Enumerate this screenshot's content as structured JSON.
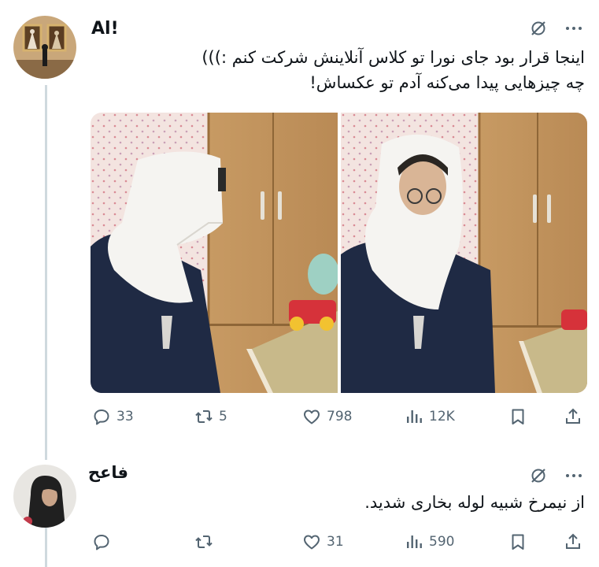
{
  "tweet": {
    "author_name": "Al!",
    "text_line1": "اینجا قرار بود جای نورا تو کلاس آنلاینش شرکت کنم :)))",
    "text_line2": "چه چیزهایی پیدا می‌کنه آدم تو عکساش!",
    "icons": {
      "grok": "grok-icon",
      "more": "more-icon"
    },
    "actions": {
      "replies": {
        "icon": "reply-icon",
        "count": "33"
      },
      "reposts": {
        "icon": "repost-icon",
        "count": "5"
      },
      "likes": {
        "icon": "heart-icon",
        "count": "798"
      },
      "views": {
        "icon": "views-icon",
        "count": "12K"
      },
      "bookmark": {
        "icon": "bookmark-icon"
      },
      "share": {
        "icon": "share-icon"
      }
    }
  },
  "reply": {
    "author_name": "فاعح",
    "text": "از نیمرخ شبیه لوله بخاری شدید.",
    "icons": {
      "grok": "grok-icon",
      "more": "more-icon"
    },
    "actions": {
      "replies": {
        "icon": "reply-icon",
        "count": ""
      },
      "reposts": {
        "icon": "repost-icon",
        "count": ""
      },
      "likes": {
        "icon": "heart-icon",
        "count": "31"
      },
      "views": {
        "icon": "views-icon",
        "count": "590"
      },
      "bookmark": {
        "icon": "bookmark-icon"
      },
      "share": {
        "icon": "share-icon"
      }
    }
  },
  "colors": {
    "text": "#0f1419",
    "secondary": "#536471",
    "thread_line": "#cfd9de"
  }
}
